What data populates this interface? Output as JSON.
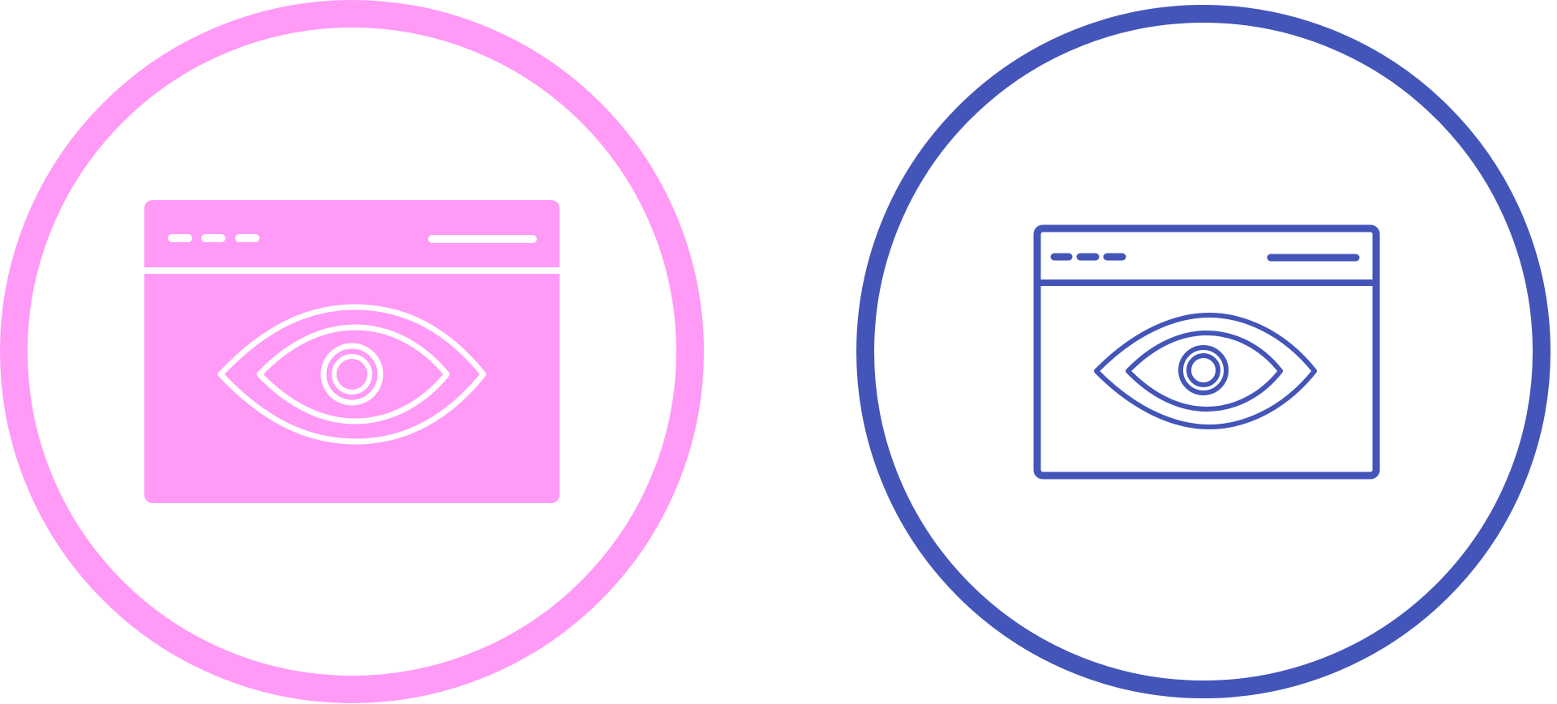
{
  "icons": [
    {
      "name": "browser-eye-glyph-icon",
      "style": "glyph",
      "ring_color": "#FF9AF7",
      "fill_color": "#FF9AF7",
      "detail_color": "#FFFFFF",
      "background": "#FFFFFF"
    },
    {
      "name": "browser-eye-line-icon",
      "style": "line",
      "ring_color": "#4355B8",
      "stroke_color": "#4355B8",
      "background": "#FFFFFF"
    }
  ]
}
